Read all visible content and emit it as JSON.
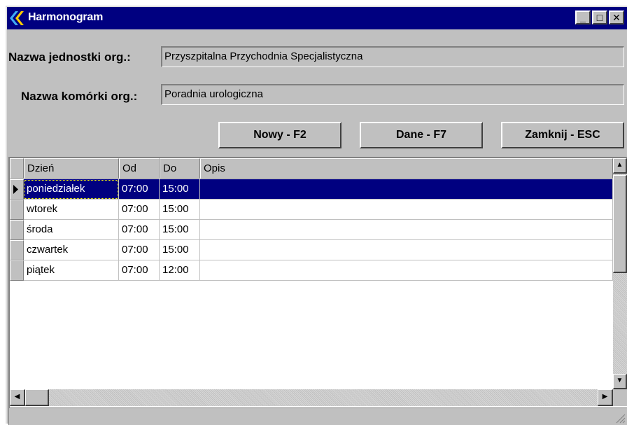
{
  "window": {
    "title": "Harmonogram",
    "buttons": {
      "minimize": "_",
      "maximize": "□",
      "close": "✕"
    }
  },
  "form": {
    "unit_label": "Nazwa jednostki org.:",
    "unit_value": "Przyszpitalna Przychodnia Specjalistyczna",
    "cell_label": "Nazwa komórki org.:",
    "cell_value": "Poradnia urologiczna"
  },
  "actions": {
    "new": "Nowy - F2",
    "data": "Dane - F7",
    "close": "Zamknij - ESC"
  },
  "grid": {
    "columns": [
      "Dzień",
      "Od",
      "Do",
      "Opis"
    ],
    "selected_row": 0,
    "rows": [
      {
        "day": "poniedziałek",
        "from": "07:00",
        "to": "15:00",
        "desc": ""
      },
      {
        "day": "wtorek",
        "from": "07:00",
        "to": "15:00",
        "desc": ""
      },
      {
        "day": "środa",
        "from": "07:00",
        "to": "15:00",
        "desc": ""
      },
      {
        "day": "czwartek",
        "from": "07:00",
        "to": "15:00",
        "desc": ""
      },
      {
        "day": "piątek",
        "from": "07:00",
        "to": "12:00",
        "desc": ""
      }
    ]
  },
  "colors": {
    "titlebar": "#000080",
    "selection": "#000080",
    "face": "#c0c0c0"
  }
}
